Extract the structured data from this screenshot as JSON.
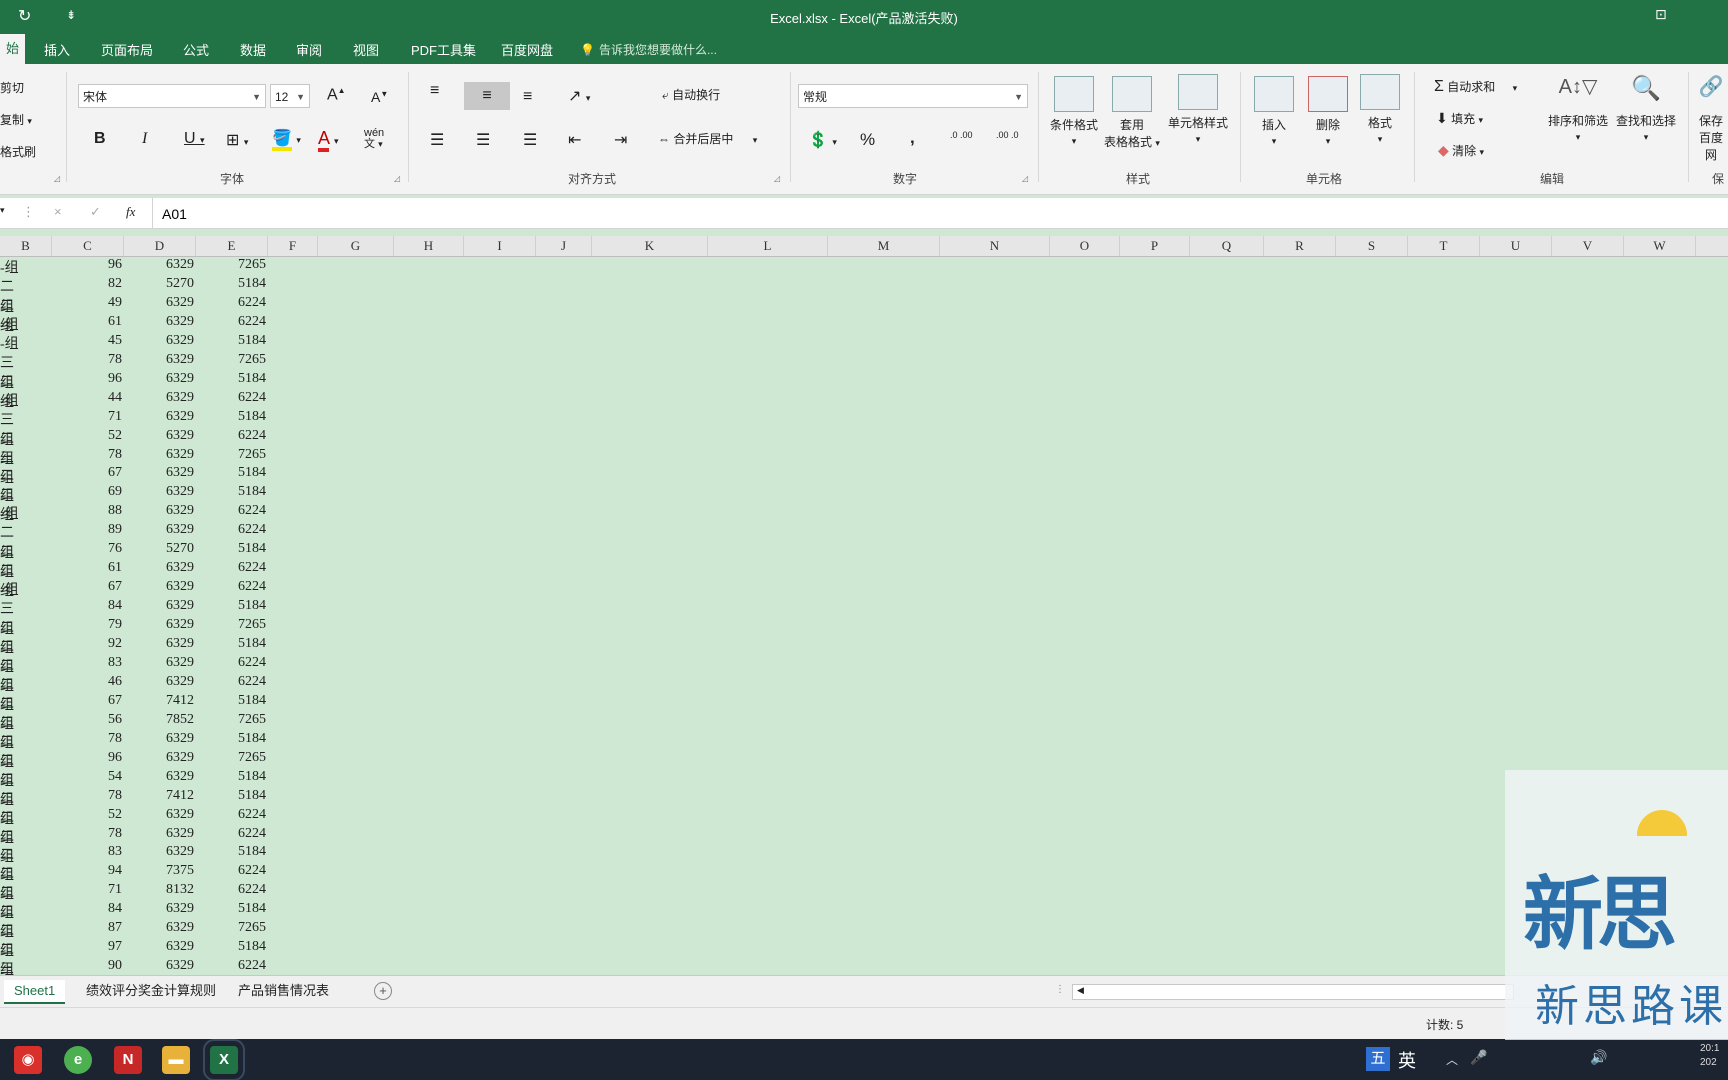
{
  "window": {
    "title": "Excel.xlsx - Excel(产品激活失败)",
    "restore_icon": "ribbon-display-icon"
  },
  "tabs": {
    "items": [
      "始",
      "插入",
      "页面布局",
      "公式",
      "数据",
      "审阅",
      "视图",
      "PDF工具集",
      "百度网盘"
    ],
    "tell_me": "告诉我您想要做什么..."
  },
  "ribbon": {
    "clipboard": {
      "cut": "剪切",
      "copy": "复制",
      "format_painter": "格式刷"
    },
    "font": {
      "label": "字体",
      "name": "宋体",
      "size": "12",
      "bold": "B",
      "italic": "I",
      "underline": "U",
      "increase": "A",
      "decrease": "A",
      "color_letter": "A",
      "phonetic": "wén"
    },
    "alignment": {
      "label": "对齐方式",
      "wrap": "自动换行",
      "merge": "合并后居中"
    },
    "number": {
      "label": "数字",
      "format": "常规",
      "percent": "%",
      "comma": ",",
      "inc_decimal": ".0 .00",
      "dec_decimal": ".00 .0"
    },
    "styles": {
      "label": "样式",
      "conditional": "条件格式",
      "table_line1": "套用",
      "table_line2": "表格格式",
      "cell_styles": "单元格样式"
    },
    "cells": {
      "label": "单元格",
      "insert": "插入",
      "delete": "删除",
      "format": "格式"
    },
    "editing": {
      "label": "编辑",
      "autosum": "自动求和",
      "fill": "填充",
      "clear": "清除",
      "sort_filter": "排序和筛选",
      "find_select": "查找和选择"
    },
    "save": {
      "line1": "保存",
      "line2": "百度网",
      "group_label": "保"
    }
  },
  "formula_bar": {
    "fx": "fx",
    "content": "A01",
    "cancel": "×",
    "enter": "✓"
  },
  "columns": [
    "B",
    "C",
    "D",
    "E",
    "F",
    "G",
    "H",
    "I",
    "J",
    "K",
    "L",
    "M",
    "N",
    "O",
    "P",
    "Q",
    "R",
    "S",
    "T",
    "U",
    "V",
    "W"
  ],
  "rows": [
    {
      "b": "-组",
      "c": "96",
      "d": "6329",
      "e": "7265"
    },
    {
      "b": "二组",
      "c": "82",
      "d": "5270",
      "e": "5184"
    },
    {
      "b": "二组",
      "c": "49",
      "d": "6329",
      "e": "6224"
    },
    {
      "b": "-组",
      "c": "61",
      "d": "6329",
      "e": "6224"
    },
    {
      "b": "-组",
      "c": "45",
      "d": "6329",
      "e": "5184"
    },
    {
      "b": "三组",
      "c": "78",
      "d": "6329",
      "e": "7265"
    },
    {
      "b": "二组",
      "c": "96",
      "d": "6329",
      "e": "5184"
    },
    {
      "b": "-组",
      "c": "44",
      "d": "6329",
      "e": "6224"
    },
    {
      "b": "三组",
      "c": "71",
      "d": "6329",
      "e": "5184"
    },
    {
      "b": "二组",
      "c": "52",
      "d": "6329",
      "e": "6224"
    },
    {
      "b": "三组",
      "c": "78",
      "d": "6329",
      "e": "7265"
    },
    {
      "b": "二组",
      "c": "67",
      "d": "6329",
      "e": "5184"
    },
    {
      "b": "二组",
      "c": "69",
      "d": "6329",
      "e": "5184"
    },
    {
      "b": "-组",
      "c": "88",
      "d": "6329",
      "e": "6224"
    },
    {
      "b": "二组",
      "c": "89",
      "d": "6329",
      "e": "6224"
    },
    {
      "b": "二组",
      "c": "76",
      "d": "5270",
      "e": "5184"
    },
    {
      "b": "二组",
      "c": "61",
      "d": "6329",
      "e": "6224"
    },
    {
      "b": "-组",
      "c": "67",
      "d": "6329",
      "e": "6224"
    },
    {
      "b": "三组",
      "c": "84",
      "d": "6329",
      "e": "5184"
    },
    {
      "b": "二组",
      "c": "79",
      "d": "6329",
      "e": "7265"
    },
    {
      "b": "二组",
      "c": "92",
      "d": "6329",
      "e": "5184"
    },
    {
      "b": "二组",
      "c": "83",
      "d": "6329",
      "e": "6224"
    },
    {
      "b": "二组",
      "c": "46",
      "d": "6329",
      "e": "6224"
    },
    {
      "b": "二组",
      "c": "67",
      "d": "7412",
      "e": "5184"
    },
    {
      "b": "二组",
      "c": "56",
      "d": "7852",
      "e": "7265"
    },
    {
      "b": "二组",
      "c": "78",
      "d": "6329",
      "e": "5184"
    },
    {
      "b": "二组",
      "c": "96",
      "d": "6329",
      "e": "7265"
    },
    {
      "b": "二组",
      "c": "54",
      "d": "6329",
      "e": "5184"
    },
    {
      "b": "二组",
      "c": "78",
      "d": "7412",
      "e": "5184"
    },
    {
      "b": "二组",
      "c": "52",
      "d": "6329",
      "e": "6224"
    },
    {
      "b": "二组",
      "c": "78",
      "d": "6329",
      "e": "6224"
    },
    {
      "b": "二组",
      "c": "83",
      "d": "6329",
      "e": "5184"
    },
    {
      "b": "二组",
      "c": "94",
      "d": "7375",
      "e": "6224"
    },
    {
      "b": "二组",
      "c": "71",
      "d": "8132",
      "e": "6224"
    },
    {
      "b": "二组",
      "c": "84",
      "d": "6329",
      "e": "5184"
    },
    {
      "b": "二组",
      "c": "87",
      "d": "6329",
      "e": "7265"
    },
    {
      "b": "二组",
      "c": "97",
      "d": "6329",
      "e": "5184"
    },
    {
      "b": "三组",
      "c": "90",
      "d": "6329",
      "e": "6224"
    }
  ],
  "sheets": {
    "tabs": [
      "Sheet1",
      "绩效评分奖金计算规则",
      "产品销售情况表"
    ],
    "add": "+"
  },
  "status": {
    "count": "计数: 5"
  },
  "taskbar": {
    "ime1": "五",
    "ime2": "英",
    "time": "20:1",
    "date": "202"
  },
  "watermark": {
    "text": "新思路课",
    "logo_text": "新思"
  },
  "colors": {
    "excel_green": "#217346",
    "sheet_bg": "#cfe8d3"
  }
}
